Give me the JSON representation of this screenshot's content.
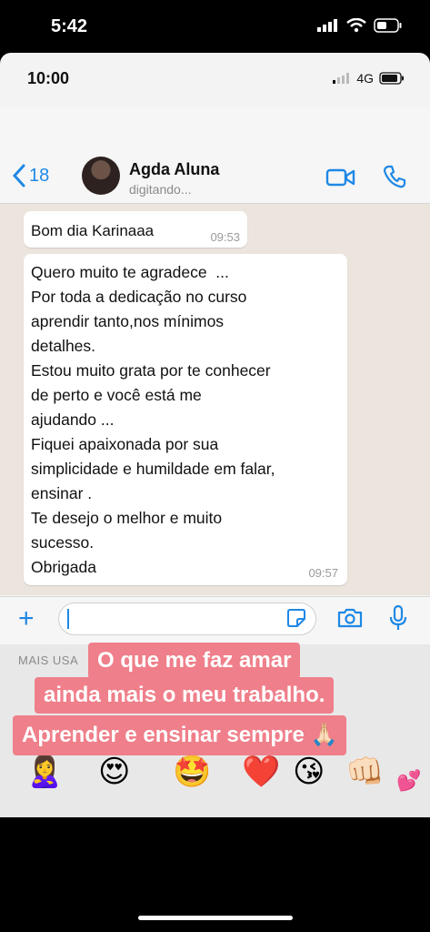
{
  "outer_status": {
    "time": "5:42"
  },
  "inner_status": {
    "time": "10:00",
    "network": "4G"
  },
  "chat_header": {
    "back_count": "18",
    "contact_name": "Agda Aluna",
    "contact_status": "digitando..."
  },
  "messages": [
    {
      "text": "Bom dia Karinaaa",
      "time": "09:53"
    },
    {
      "lines": [
        "Quero muito te agradece  ...",
        "Por toda a dedicação no curso",
        "aprendir tanto,nos mínimos",
        "detalhes.",
        "Estou muito grata por te conhecer",
        "de perto e você está me",
        "ajudando ...",
        "Fiquei apaixonada por sua",
        "simplicidade e humildade em falar,",
        "ensinar .",
        "Te desejo o melhor e muito",
        "sucesso.",
        "Obrigada"
      ],
      "time": "09:57"
    }
  ],
  "input": {
    "placeholder": ""
  },
  "keyboard": {
    "section_label": "MAIS USA",
    "emojis": [
      "🙎‍♀️",
      "😍",
      "🤩",
      "❤️",
      "😘",
      "👊🏻",
      "💕"
    ]
  },
  "captions": [
    "O que me faz amar",
    "ainda mais o meu trabalho.",
    "Aprender e ensinar sempre 🙏🏻"
  ],
  "colors": {
    "accent": "#1e88e5",
    "caption_bg": "#ef7f8a",
    "chat_bg": "#ece5dd"
  }
}
